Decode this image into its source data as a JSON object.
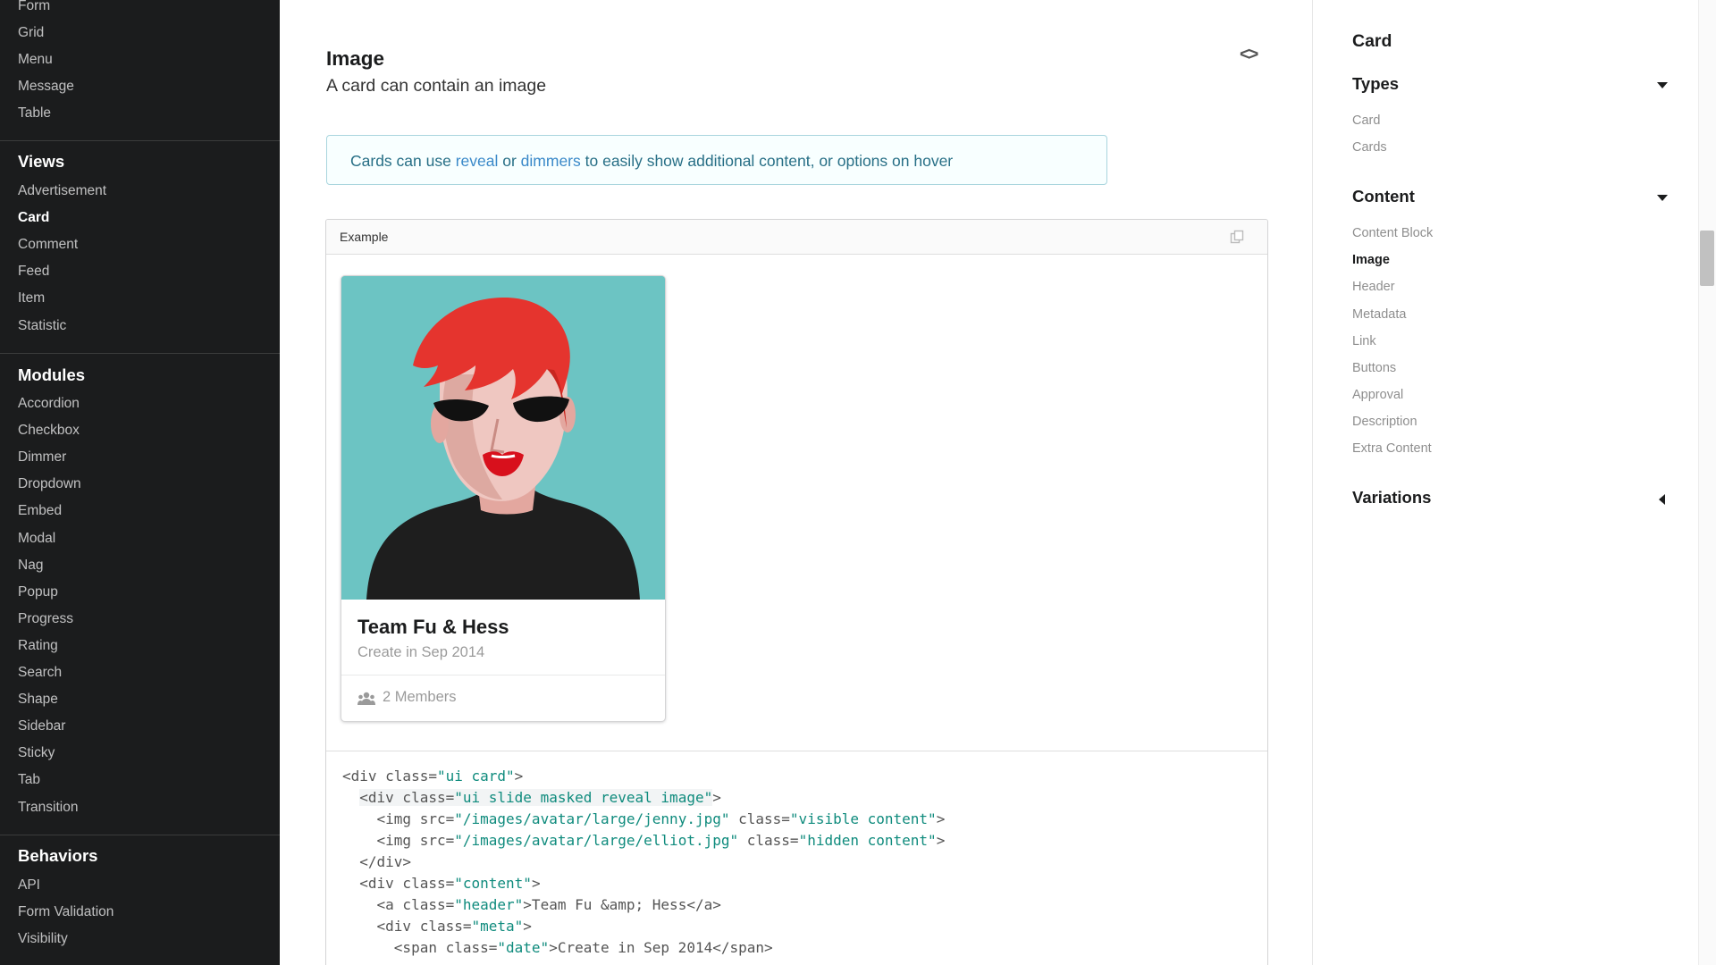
{
  "left_nav": {
    "top_items": [
      "Form",
      "Grid",
      "Menu",
      "Message",
      "Table"
    ],
    "views": {
      "header": "Views",
      "items": [
        "Advertisement",
        "Card",
        "Comment",
        "Feed",
        "Item",
        "Statistic"
      ],
      "active": "Card"
    },
    "modules": {
      "header": "Modules",
      "items": [
        "Accordion",
        "Checkbox",
        "Dimmer",
        "Dropdown",
        "Embed",
        "Modal",
        "Nag",
        "Popup",
        "Progress",
        "Rating",
        "Search",
        "Shape",
        "Sidebar",
        "Sticky",
        "Tab",
        "Transition"
      ]
    },
    "behaviors": {
      "header": "Behaviors",
      "items": [
        "API",
        "Form Validation",
        "Visibility"
      ]
    }
  },
  "main": {
    "title": "Image",
    "description": "A card can contain an image",
    "code_toggle": "<>",
    "info": {
      "prefix": "Cards can use ",
      "link1": "reveal",
      "middle": " or ",
      "link2": "dimmers",
      "suffix": " to easily show additional content, or options on hover"
    },
    "example": {
      "label": "Example",
      "card": {
        "header": "Team Fu & Hess",
        "meta": "Create in Sep 2014",
        "extra": "2 Members"
      },
      "code_lines": [
        [
          [
            "t",
            "<div class="
          ],
          [
            "s",
            "\"ui card\""
          ],
          [
            "t",
            ">"
          ]
        ],
        [
          [
            "t",
            "  "
          ],
          [
            "w",
            "<div class="
          ],
          [
            "ws",
            "\"ui slide masked reveal image\""
          ],
          [
            "t",
            ">"
          ]
        ],
        [
          [
            "t",
            "    <img src="
          ],
          [
            "s",
            "\"/images/avatar/large/jenny.jpg\""
          ],
          [
            "t",
            " class="
          ],
          [
            "s",
            "\"visible content\""
          ],
          [
            "t",
            ">"
          ]
        ],
        [
          [
            "t",
            "    <img src="
          ],
          [
            "s",
            "\"/images/avatar/large/elliot.jpg\""
          ],
          [
            "t",
            " class="
          ],
          [
            "s",
            "\"hidden content\""
          ],
          [
            "t",
            ">"
          ]
        ],
        [
          [
            "t",
            "  </div>"
          ]
        ],
        [
          [
            "t",
            "  <div class="
          ],
          [
            "s",
            "\"content\""
          ],
          [
            "t",
            ">"
          ]
        ],
        [
          [
            "t",
            "    <a class="
          ],
          [
            "s",
            "\"header\""
          ],
          [
            "t",
            ">Team Fu &amp; Hess</a>"
          ]
        ],
        [
          [
            "t",
            "    <div class="
          ],
          [
            "s",
            "\"meta\""
          ],
          [
            "t",
            ">"
          ]
        ],
        [
          [
            "t",
            "      <span class="
          ],
          [
            "s",
            "\"date\""
          ],
          [
            "t",
            ">Create in Sep 2014</span>"
          ]
        ]
      ]
    }
  },
  "toc": {
    "title": "Card",
    "sections": [
      {
        "label": "Types",
        "expanded": true,
        "items": [
          "Card",
          "Cards"
        ]
      },
      {
        "label": "Content",
        "expanded": true,
        "items": [
          "Content Block",
          "Image",
          "Header",
          "Metadata",
          "Link",
          "Buttons",
          "Approval",
          "Description",
          "Extra Content"
        ]
      },
      {
        "label": "Variations",
        "expanded": false,
        "items": []
      }
    ],
    "active_item": "Image"
  }
}
